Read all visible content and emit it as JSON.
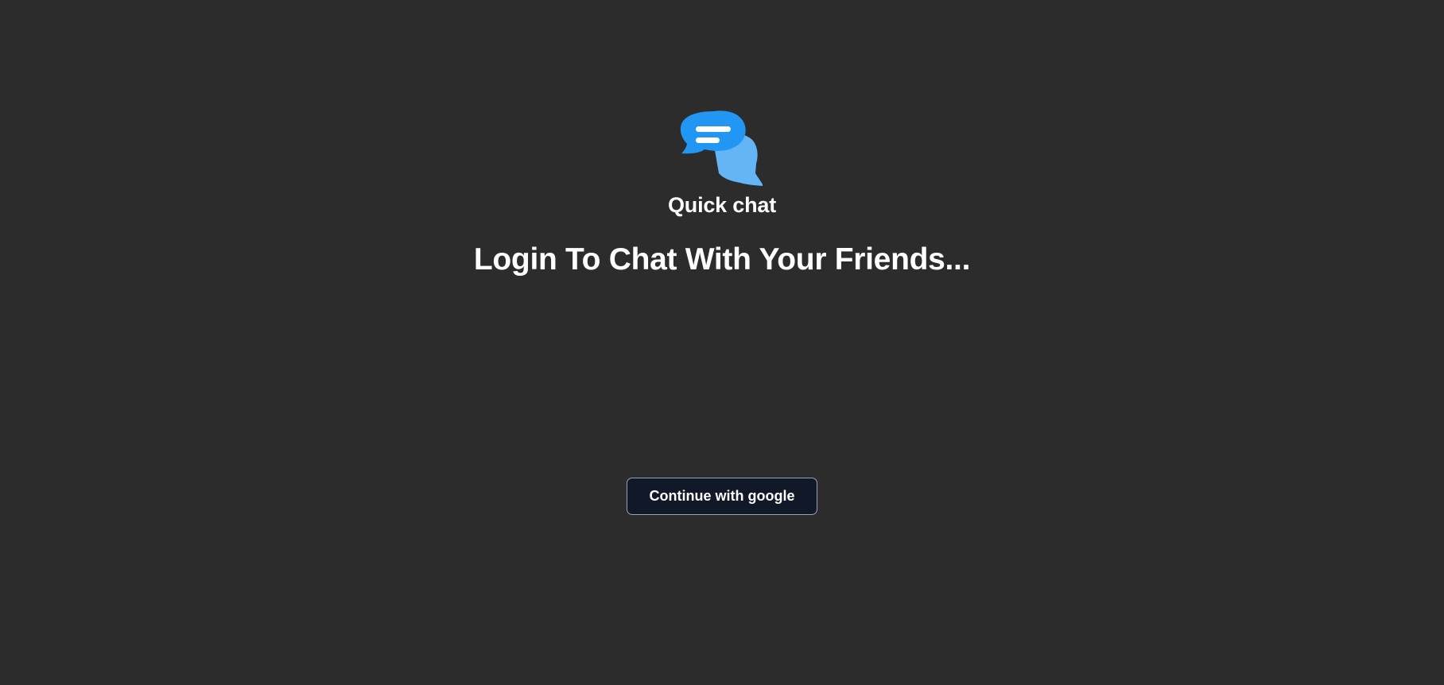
{
  "app": {
    "name": "Quick chat",
    "logo_icon": "chat-bubbles-icon",
    "colors": {
      "background": "#2c2c2c",
      "logo_primary": "#2196f3",
      "logo_secondary": "#64b5f6",
      "button_background": "#111827",
      "button_border": "#9ca3af"
    }
  },
  "login": {
    "headline": "Login To Chat With Your Friends...",
    "google_button_label": "Continue with google"
  }
}
